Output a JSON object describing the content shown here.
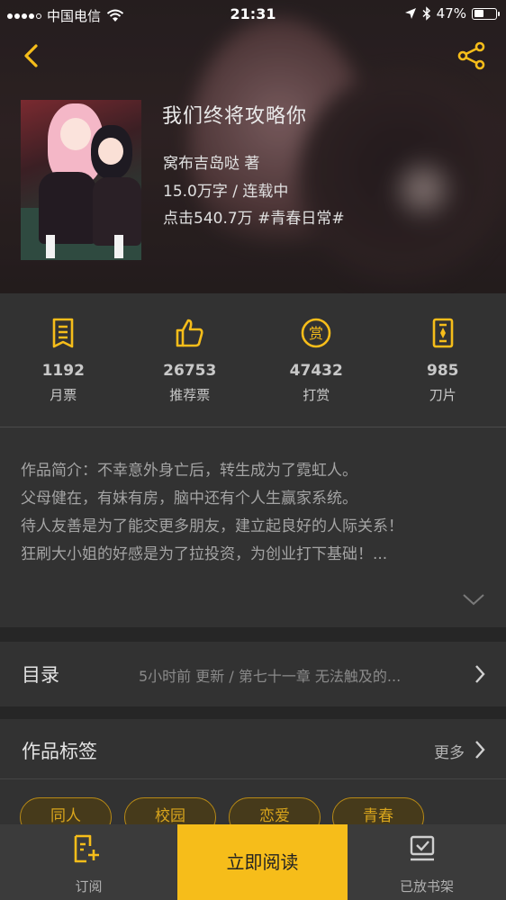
{
  "status_bar": {
    "carrier": "中国电信",
    "time": "21:31",
    "battery": "47%",
    "battery_level": 0.47
  },
  "book": {
    "title": "我们终将攻略你",
    "author_line": "窝布吉岛哒  著",
    "words_status": "15.0万字 / 连载中",
    "clicks_tag": "点击540.7万  #青春日常#"
  },
  "stats": [
    {
      "icon": "monthly-ticket-icon",
      "value": "1192",
      "label": "月票"
    },
    {
      "icon": "thumbs-up-icon",
      "value": "26753",
      "label": "推荐票"
    },
    {
      "icon": "reward-coin-icon",
      "value": "47432",
      "label": "打赏"
    },
    {
      "icon": "blade-icon",
      "value": "985",
      "label": "刀片"
    }
  ],
  "description": [
    "作品简介：不幸意外身亡后，转生成为了霓虹人。",
    "父母健在，有妹有房，脑中还有个人生赢家系统。",
    "待人友善是为了能交更多朋友，建立起良好的人际关系！",
    "狂刷大小姐的好感是为了拉投资，为创业打下基础！..."
  ],
  "toc": {
    "title": "目录",
    "info": "5小时前 更新 / 第七十一章  无法触及的..."
  },
  "tags": {
    "title": "作品标签",
    "more": "更多",
    "items": [
      "同人",
      "校园",
      "恋爱",
      "青春"
    ]
  },
  "bottom_bar": {
    "subscribe": "订阅",
    "read_now": "立即阅读",
    "on_shelf": "已放书架"
  },
  "colors": {
    "accent": "#f6bd1a",
    "background": "#323232",
    "tag_text": "#d9a51c"
  }
}
